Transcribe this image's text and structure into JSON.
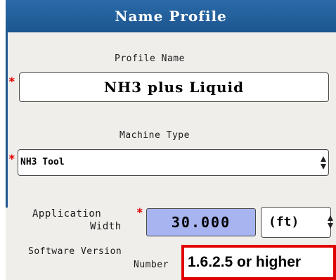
{
  "header": {
    "title": "Name Profile"
  },
  "profile_name": {
    "label": "Profile Name",
    "value": "NH3 plus Liquid",
    "required_marker": "*"
  },
  "machine_type": {
    "label": "Machine Type",
    "value": "NH3 Tool",
    "required_marker": "*"
  },
  "application_width": {
    "label_line1": "Application",
    "label_line2": "Width",
    "required_marker": "*",
    "value": "30.000",
    "unit": "(ft)"
  },
  "software_version": {
    "label_line1": "Software Version",
    "label_line2": "Number",
    "callout": "1.6.2.5 or higher"
  },
  "colors": {
    "header_bg": "#1d5690",
    "panel_bg": "#f0eeea",
    "required": "#e00000",
    "width_field_bg": "#a8b4f0",
    "callout_border": "#e00000"
  },
  "icons": [
    "spinner-arrows-icon"
  ]
}
